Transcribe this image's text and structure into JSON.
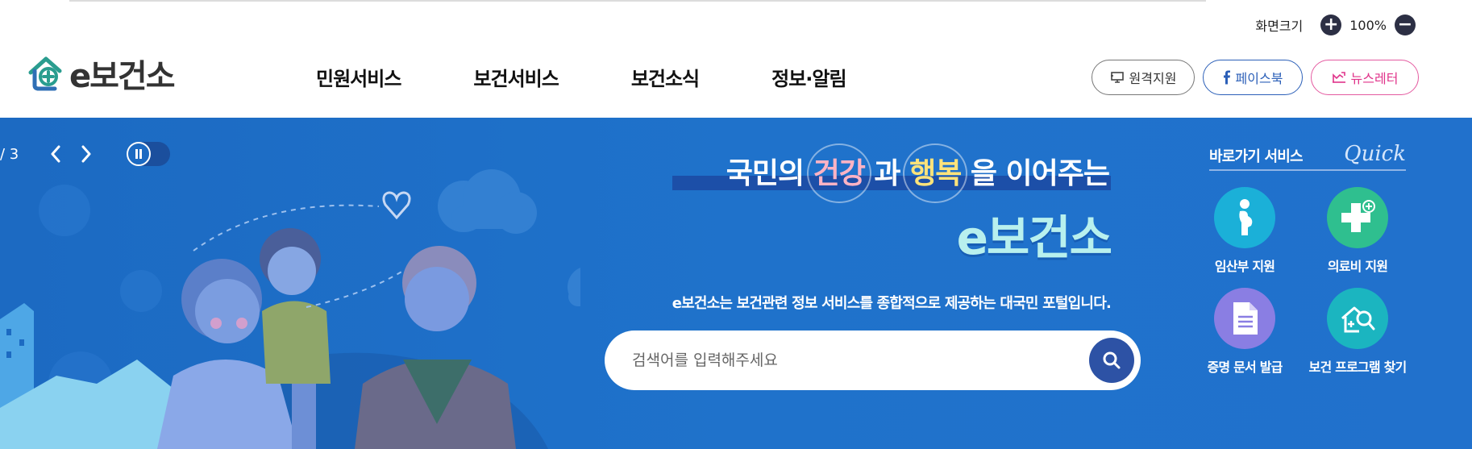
{
  "utility": {
    "zoom_label": "화면크기",
    "zoom_value": "100%"
  },
  "logo": {
    "text": "e보건소"
  },
  "gnb": [
    "민원서비스",
    "보건서비스",
    "보건소식",
    "정보·알림"
  ],
  "header_links": {
    "remote": "원격지원",
    "facebook": "페이스북",
    "newsletter": "뉴스레터"
  },
  "hero": {
    "slide_counter": "/ 3",
    "headline": {
      "part1": "국민의 ",
      "health": "건강",
      "part2": " 과 ",
      "happiness": "행복",
      "part3": " 을 이어주는",
      "brand": "e보건소",
      "description": "e보건소는 보건관련 정보 서비스를 종합적으로 제공하는 대국민 포털입니다."
    },
    "search": {
      "placeholder": "검색어를 입력해주세요"
    }
  },
  "quick": {
    "title": "바로가기 서비스",
    "script": "Quick",
    "items": [
      {
        "label": "임산부 지원",
        "icon": "pregnant-icon",
        "color": "#1bb0d8"
      },
      {
        "label": "의료비 지원",
        "icon": "medical-cross-icon",
        "color": "#2fbf8f"
      },
      {
        "label": "증명 문서 발급",
        "icon": "document-icon",
        "color": "#8a7ee3"
      },
      {
        "label": "보건 프로그램 찾기",
        "icon": "search-house-icon",
        "color": "#1bb5c0"
      }
    ]
  },
  "colors": {
    "hero_blue": "#1f72cb",
    "brand_teal": "#2a9d8f",
    "facebook_blue": "#2b5fb8",
    "newsletter_pink": "#e0338a",
    "search_button": "#2d52a5"
  }
}
